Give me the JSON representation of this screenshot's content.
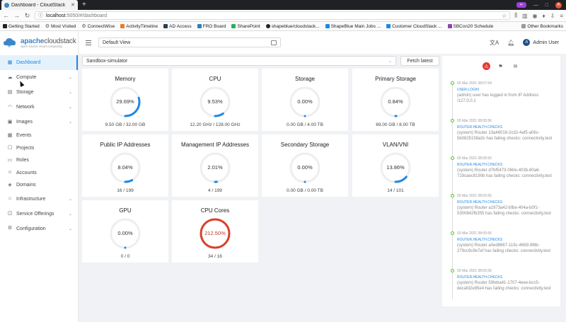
{
  "browser": {
    "tab_title": "Dashboard - CloudStack",
    "url_host": "localhost",
    "url_path": ":5050/#/dashboard",
    "bookmarks": [
      "Getting Started",
      "Most Visited",
      "ConnectWise",
      "ActivityTimeline",
      "AD Access",
      "FRO Board",
      "SharePoint",
      "shapeblue/cloudstack...",
      "ShapeBlue Main Jobs ...",
      "Customer CloudStack ...",
      "SBCon20 Schedule"
    ],
    "other_bookmarks": "Other Bookmarks"
  },
  "brand": {
    "name_bold": "apache",
    "name_thin": "cloudstack",
    "tagline": "open source cloud computing"
  },
  "sidebar": {
    "items": [
      {
        "label": "Dashboard",
        "icon": "dashboard-icon",
        "active": true,
        "chevron": false
      },
      {
        "label": "Compute",
        "icon": "cloud-icon",
        "chevron": true
      },
      {
        "label": "Storage",
        "icon": "database-icon",
        "chevron": true
      },
      {
        "label": "Network",
        "icon": "wifi-icon",
        "chevron": true
      },
      {
        "label": "Images",
        "icon": "picture-icon",
        "chevron": true
      },
      {
        "label": "Events",
        "icon": "calendar-icon",
        "chevron": false
      },
      {
        "label": "Projects",
        "icon": "project-icon",
        "chevron": false
      },
      {
        "label": "Roles",
        "icon": "idcard-icon",
        "chevron": false
      },
      {
        "label": "Accounts",
        "icon": "team-icon",
        "chevron": false
      },
      {
        "label": "Domains",
        "icon": "block-icon",
        "chevron": false
      },
      {
        "label": "Infrastructure",
        "icon": "bank-icon",
        "chevron": true
      },
      {
        "label": "Service Offerings",
        "icon": "shopping-icon",
        "chevron": true
      },
      {
        "label": "Configuration",
        "icon": "setting-icon",
        "chevron": true
      }
    ]
  },
  "header": {
    "view_label": "Default View",
    "user_name": "Admin User",
    "user_initial": "A"
  },
  "toolbar": {
    "zone": "Sandbox-simulator",
    "fetch_label": "Fetch latest"
  },
  "cards": [
    {
      "title": "Memory",
      "value": "29.69%",
      "percent": 29.69,
      "footer": "9.50 GB / 32.00 GB"
    },
    {
      "title": "CPU",
      "value": "9.53%",
      "percent": 9.53,
      "footer": "12.20 GHz / 128.00 GHz"
    },
    {
      "title": "Storage",
      "value": "0.00%",
      "percent": 0,
      "footer": "0.00 GB / 4.00 TB"
    },
    {
      "title": "Primary Storage",
      "value": "0.84%",
      "percent": 0.84,
      "footer": "69.00 GB / 8.00 TB"
    },
    {
      "title": "Public IP Addresses",
      "value": "8.04%",
      "percent": 8.04,
      "footer": "16 / 199"
    },
    {
      "title": "Management IP Addresses",
      "value": "2.01%",
      "percent": 2.01,
      "footer": "4 / 199"
    },
    {
      "title": "Secondary Storage",
      "value": "0.00%",
      "percent": 0,
      "footer": "0.00 GB / 0.00 TB"
    },
    {
      "title": "VLAN/VNI",
      "value": "13.86%",
      "percent": 13.86,
      "footer": "14 / 101"
    },
    {
      "title": "GPU",
      "value": "0.00%",
      "percent": 0,
      "footer": "0 / 0"
    },
    {
      "title": "CPU Cores",
      "value": "212.50%",
      "percent": 212.5,
      "footer": "34 / 16",
      "danger": true
    }
  ],
  "colors": {
    "accent": "#1e88e5",
    "danger": "#d9402b",
    "track": "#eeeeee",
    "event_dot": "#52c41a"
  },
  "events": [
    {
      "date": "03 Mar 2021 08:07:54",
      "type": "USER.LOGIN",
      "desc": "(admin) user has logged in from IP Address /127.0.0.1"
    },
    {
      "date": "03 Mar 2021 08:05:56",
      "type": "ROUTER.HEALTH.CHECKS",
      "desc": "(system) Router 13a46018-2cd2-4af5-a06c-5b0825158a3c has failing checks: connectivity.test"
    },
    {
      "date": "03 Mar 2021 08:05:56",
      "type": "ROUTER.HEALTH.CHECKS",
      "desc": "(system) Router d7bf5473-060e-403b-80a6-719caec8190b has failing checks: connectivity.test"
    },
    {
      "date": "03 Mar 2021 08:05:56",
      "type": "ROUTER.HEALTH.CHECKS",
      "desc": "(system) Router a1973a42-bfbe-404a-b0f1-5300842fb355 has failing checks: connectivity.test"
    },
    {
      "date": "03 Mar 2021 08:05:56",
      "type": "ROUTER.HEALTH.CHECKS",
      "desc": "(system) Router a0ed8667-119c-4669-9f8b-279cc9c9e7ef has failing checks: connectivity.test"
    },
    {
      "date": "03 Mar 2021 08:05:56",
      "type": "ROUTER.HEALTH.CHECKS",
      "desc": "(system) Router 59feba41-1707-4eee-bcc5-decafd2e85e4 has failing checks: connectivity.test"
    }
  ]
}
